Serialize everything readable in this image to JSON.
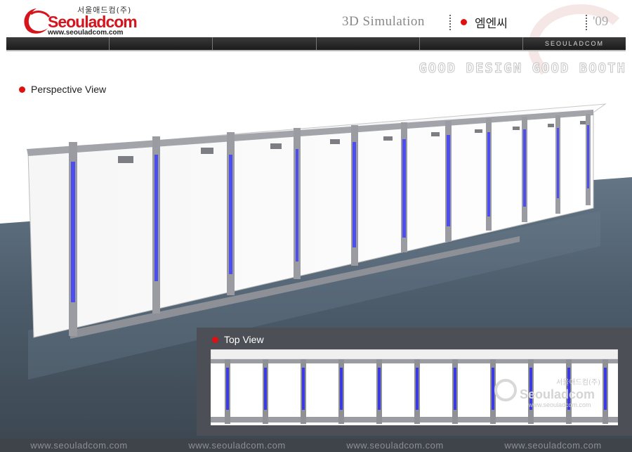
{
  "brand": {
    "name": "Seouladcom",
    "korean_name": "서울애드컴(주)",
    "url": "www.seouladcom.com"
  },
  "header": {
    "title": "3D Simulation",
    "client": "엠엔씨",
    "year": "'09",
    "nav_label": "SEOULADCOM",
    "tagline": "GOOD DESIGN GOOD BOOTH"
  },
  "views": {
    "perspective": "Perspective View",
    "top": "Top View"
  },
  "watermark": {
    "korean_name": "서울애드컴(주)",
    "name": "Seouladcom",
    "url": "www.seouladcom.com"
  },
  "footer": {
    "links": [
      "www.seouladcom.com",
      "www.seouladcom.com",
      "www.seouladcom.com",
      "www.seouladcom.com"
    ]
  },
  "colors": {
    "accent": "#e01010",
    "brand_red": "#d5141c",
    "floor": "#4a5967",
    "truss": "#9a9ca2",
    "tube": "#4d4df0"
  },
  "icons": [
    "seouladcom-logo",
    "bullet-dot-icon"
  ]
}
